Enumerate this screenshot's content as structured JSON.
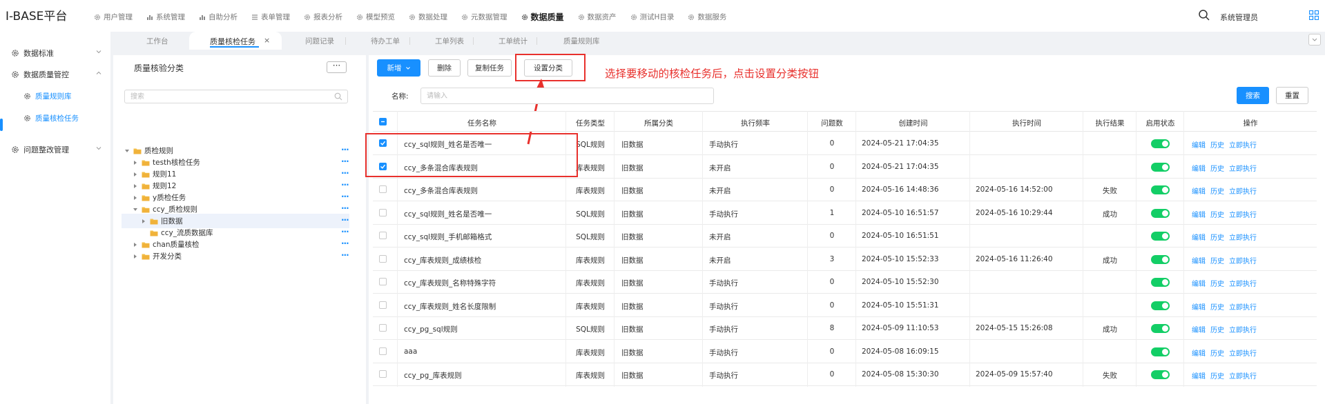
{
  "app": {
    "title": "I-BASE平台"
  },
  "nav": [
    {
      "label": "用户管理",
      "icon": "gear-icon"
    },
    {
      "label": "系统管理",
      "icon": "bar-chart-icon"
    },
    {
      "label": "自助分析",
      "icon": "bar-chart-icon"
    },
    {
      "label": "表单管理",
      "icon": "list-icon"
    },
    {
      "label": "报表分析",
      "icon": "gear-icon"
    },
    {
      "label": "模型预览",
      "icon": "gear-icon"
    },
    {
      "label": "数据处理",
      "icon": "gear-icon"
    },
    {
      "label": "元数据管理",
      "icon": "gear-icon"
    },
    {
      "label": "数据质量",
      "icon": "gear-icon",
      "active": true
    },
    {
      "label": "数据资产",
      "icon": "gear-icon"
    },
    {
      "label": "测试H目录",
      "icon": "gear-icon"
    },
    {
      "label": "数据服务",
      "icon": "gear-icon"
    }
  ],
  "user": {
    "name": "系统管理员"
  },
  "sidebar": {
    "items": [
      {
        "label": "数据标准"
      },
      {
        "label": "数据质量管控"
      },
      {
        "label": "问题整改管理"
      }
    ],
    "sub_items": [
      {
        "label": "质量规则库"
      },
      {
        "label": "质量核检任务"
      }
    ]
  },
  "tabs": {
    "items": [
      "工作台",
      "问题记录",
      "待办工单",
      "工单列表",
      "工单统计",
      "质量规则库"
    ],
    "active": "质量核检任务",
    "close": "×"
  },
  "tree": {
    "title": "质量核验分类",
    "more": "···",
    "search_placeholder": "搜索",
    "nodes": [
      "质检规则",
      "testh核检任务",
      "规则11",
      "规则12",
      "y质检任务",
      "ccy_质检规则",
      "旧数据",
      "ccy_流质数据库",
      "chan质量核检",
      "开发分类"
    ],
    "row_more": "···"
  },
  "toolbar": {
    "add": "新增",
    "delete": "删除",
    "copy": "复制任务",
    "set_category": "设置分类",
    "search": "搜索",
    "reset": "重置"
  },
  "annotation": {
    "text": "选择要移动的核检任务后，点击设置分类按钮",
    "color": "#e8302c"
  },
  "filter": {
    "label": "名称:",
    "placeholder": "请输入"
  },
  "table": {
    "columns": [
      "任务名称",
      "任务类型",
      "所属分类",
      "执行频率",
      "问题数",
      "创建时间",
      "执行时间",
      "执行结果",
      "启用状态",
      "操作"
    ],
    "actions": [
      "编辑",
      "历史",
      "立即执行"
    ],
    "rows": [
      {
        "name": "ccy_sql规则_姓名是否唯一",
        "type": "SQL规则",
        "category": "旧数据",
        "freq": "手动执行",
        "issues": "0",
        "created": "2024-05-21 17:04:35",
        "executed": "",
        "result": "",
        "checked": true
      },
      {
        "name": "ccy_多条混合库表规则",
        "type": "库表规则",
        "category": "旧数据",
        "freq": "未开启",
        "issues": "0",
        "created": "2024-05-21 17:04:35",
        "executed": "",
        "result": "",
        "checked": true
      },
      {
        "name": "ccy_多条混合库表规则",
        "type": "库表规则",
        "category": "旧数据",
        "freq": "未开启",
        "issues": "0",
        "created": "2024-05-16 14:48:36",
        "executed": "2024-05-16 14:52:00",
        "result": "失败",
        "checked": false
      },
      {
        "name": "ccy_sql规则_姓名是否唯一",
        "type": "SQL规则",
        "category": "旧数据",
        "freq": "手动执行",
        "issues": "1",
        "created": "2024-05-10 16:51:57",
        "executed": "2024-05-16 10:29:44",
        "result": "成功",
        "checked": false
      },
      {
        "name": "ccy_sql规则_手机邮箱格式",
        "type": "SQL规则",
        "category": "旧数据",
        "freq": "未开启",
        "issues": "0",
        "created": "2024-05-10 16:51:51",
        "executed": "",
        "result": "",
        "checked": false
      },
      {
        "name": "ccy_库表规则_成绩核检",
        "type": "库表规则",
        "category": "旧数据",
        "freq": "未开启",
        "issues": "3",
        "created": "2024-05-10 15:52:33",
        "executed": "2024-05-16 11:26:40",
        "result": "成功",
        "checked": false
      },
      {
        "name": "ccy_库表规则_名称特殊字符",
        "type": "库表规则",
        "category": "旧数据",
        "freq": "手动执行",
        "issues": "0",
        "created": "2024-05-10 15:52:30",
        "executed": "",
        "result": "",
        "checked": false
      },
      {
        "name": "ccy_库表规则_姓名长度限制",
        "type": "库表规则",
        "category": "旧数据",
        "freq": "手动执行",
        "issues": "0",
        "created": "2024-05-10 15:51:31",
        "executed": "",
        "result": "",
        "checked": false
      },
      {
        "name": "ccy_pg_sql规则",
        "type": "SQL规则",
        "category": "旧数据",
        "freq": "手动执行",
        "issues": "8",
        "created": "2024-05-09 11:10:53",
        "executed": "2024-05-15 15:26:08",
        "result": "成功",
        "checked": false
      },
      {
        "name": "aaa",
        "type": "库表规则",
        "category": "旧数据",
        "freq": "手动执行",
        "issues": "0",
        "created": "2024-05-08 16:09:15",
        "executed": "",
        "result": "",
        "checked": false
      },
      {
        "name": "ccy_pg_库表规则",
        "type": "库表规则",
        "category": "旧数据",
        "freq": "手动执行",
        "issues": "0",
        "created": "2024-05-08 15:30:30",
        "executed": "2024-05-09 15:57:40",
        "result": "失败",
        "checked": false
      }
    ]
  },
  "colors": {
    "accent": "#1890ff",
    "switch_on": "#13ce66",
    "annotation": "#e8302c"
  }
}
